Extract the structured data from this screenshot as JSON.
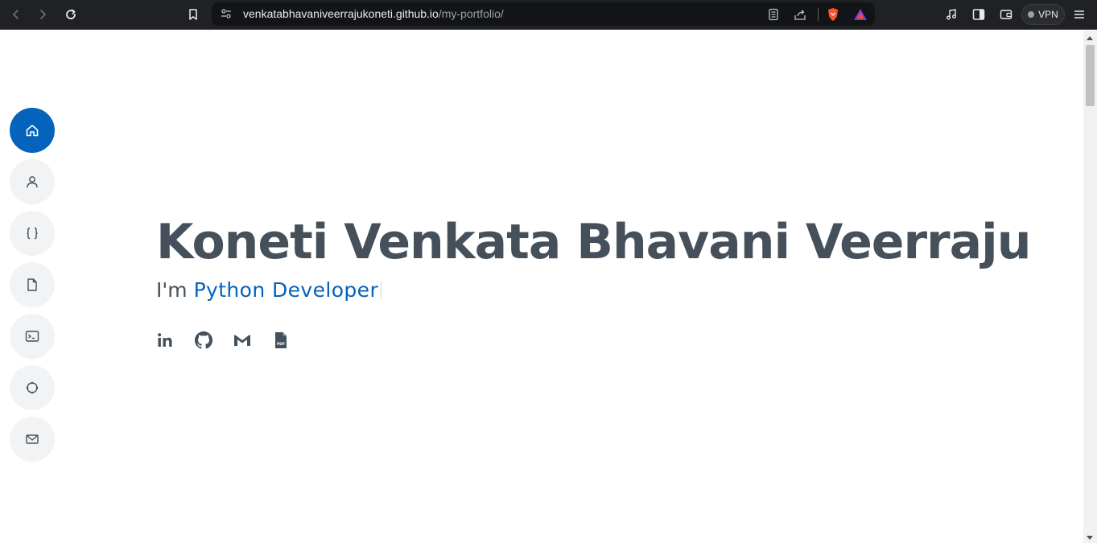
{
  "browser": {
    "url_host": "venkatabhavaniveerrajukoneti.github.io",
    "url_path": "/my-portfolio/",
    "vpn_label": "VPN",
    "icons": [
      "back-icon",
      "forward-icon",
      "reload-icon",
      "bookmark-icon",
      "site-info-icon",
      "reader-mode-icon",
      "share-icon",
      "brave-shields-icon",
      "brave-rewards-icon",
      "media-icon",
      "sidebar-icon",
      "wallet-icon",
      "menu-icon"
    ]
  },
  "nav": {
    "items": [
      {
        "name": "home",
        "icon": "home-icon",
        "active": true
      },
      {
        "name": "about",
        "icon": "person-icon",
        "active": false
      },
      {
        "name": "skills",
        "icon": "braces-icon",
        "active": false
      },
      {
        "name": "resume",
        "icon": "file-icon",
        "active": false
      },
      {
        "name": "projects",
        "icon": "terminal-icon",
        "active": false
      },
      {
        "name": "services",
        "icon": "circle-icon",
        "active": false
      },
      {
        "name": "contact",
        "icon": "envelope-icon",
        "active": false
      }
    ]
  },
  "hero": {
    "name": "Koneti Venkata Bhavani Veerraju",
    "prefix": "I'm",
    "role": "Python Developer"
  },
  "socials": [
    {
      "name": "linkedin",
      "icon": "linkedin-icon"
    },
    {
      "name": "github",
      "icon": "github-icon"
    },
    {
      "name": "gmail",
      "icon": "gmail-icon"
    },
    {
      "name": "resume-pdf",
      "icon": "pdf-file-icon",
      "label": "PDF"
    }
  ],
  "colors": {
    "accent": "#0563bb",
    "heading": "#45505b",
    "nav_bg": "#f2f3f5",
    "chrome_bg": "#202124"
  }
}
